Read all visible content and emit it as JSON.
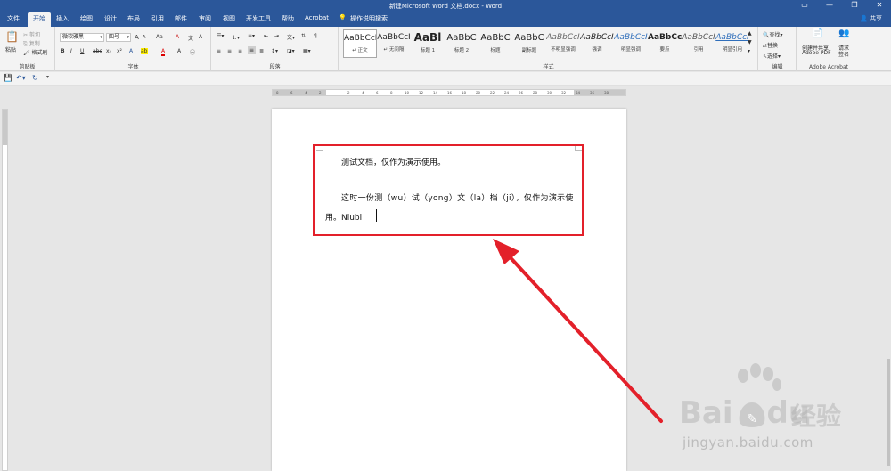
{
  "titlebar": {
    "title": "新建Microsoft Word 文档.docx  -  Word",
    "min_icon": "minimize-icon",
    "max_icon": "maximize-icon",
    "close_icon": "close-icon",
    "min": "—",
    "max": "❐",
    "close": "✕",
    "restore": "▭"
  },
  "tabs": [
    "文件",
    "开始",
    "插入",
    "绘图",
    "设计",
    "布局",
    "引用",
    "邮件",
    "审阅",
    "视图",
    "开发工具",
    "帮助",
    "Acrobat"
  ],
  "tell_me": "操作说明搜索",
  "share": "共享",
  "clipboard": {
    "paste": "粘贴",
    "cut": "剪切",
    "copy": "复制",
    "format_painter": "格式刷",
    "label": "剪贴板"
  },
  "font": {
    "name": "微软雅黑",
    "size": "四号",
    "label": "字体",
    "bold": "B",
    "italic": "I",
    "underline": "U",
    "strike": "abc",
    "sub": "x₂",
    "sup": "x²",
    "grow": "A",
    "shrink": "A",
    "case": "Aa",
    "clear": "A",
    "color": "A",
    "highlight": "ab"
  },
  "paragraph": {
    "label": "段落"
  },
  "styles": {
    "label": "样式",
    "items": [
      {
        "sample": "AaBbCcI",
        "name": "↵ 正文"
      },
      {
        "sample": "AaBbCcI",
        "name": "↵ 无间隔"
      },
      {
        "sample": "AaBl",
        "name": "标题 1"
      },
      {
        "sample": "AaBbC",
        "name": "标题 2"
      },
      {
        "sample": "AaBbC",
        "name": "标题"
      },
      {
        "sample": "AaBbC",
        "name": "副标题"
      },
      {
        "sample": "AaBbCcI",
        "name": "不明显强调"
      },
      {
        "sample": "AaBbCcI",
        "name": "强调"
      },
      {
        "sample": "AaBbCcI",
        "name": "明显强调"
      },
      {
        "sample": "AaBbCc",
        "name": "要点"
      },
      {
        "sample": "AaBbCcI",
        "name": "引用"
      },
      {
        "sample": "AaBbCcI",
        "name": "明显引用"
      }
    ]
  },
  "editing": {
    "find": "查找",
    "replace": "替换",
    "select": "选择",
    "label": "编辑"
  },
  "acrobat": {
    "create": "创建并共享",
    "create2": "Adobe PDF",
    "sign": "请求",
    "sign2": "签名",
    "label": "Adobe Acrobat"
  },
  "ruler_ticks": [
    "8",
    "6",
    "4",
    "2",
    "",
    "2",
    "4",
    "6",
    "8",
    "10",
    "12",
    "14",
    "16",
    "18",
    "20",
    "22",
    "24",
    "26",
    "28",
    "30",
    "32",
    "34",
    "36",
    "38"
  ],
  "document": {
    "line1": "测试文档，仅作为演示使用。",
    "line2": "这时一份测（wu）试（yong）文（la）档（ji），仅作为演示使",
    "line3": "用。Niubi"
  },
  "watermark": {
    "brand": "Bai",
    "brand2": "du",
    "cn": "经验",
    "url": "jingyan.baidu.com"
  },
  "colors": {
    "accent": "#2b579a",
    "highlight_box": "#e3202a",
    "arrow": "#e3202a"
  }
}
